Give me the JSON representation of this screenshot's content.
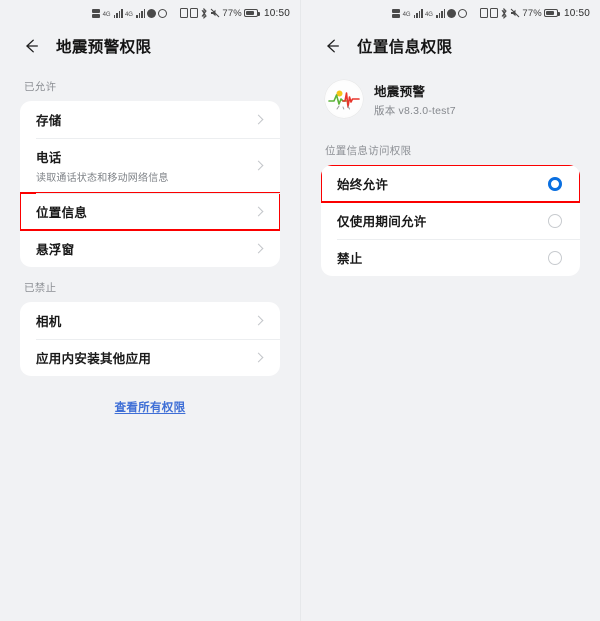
{
  "colors": {
    "page_bg": "#f1f2f4",
    "card_bg": "#ffffff",
    "accent_blue": "#0a6fe0",
    "link_blue": "#3f6fd6",
    "highlight_red": "#fb0000",
    "muted_text": "#8c8f94"
  },
  "status_bar": {
    "battery_percent": "77%",
    "time": "10:50",
    "icons": [
      "sim-dual-signal-icon",
      "signal-bars-icon",
      "signal-bars-icon",
      "circle-icon",
      "globe-icon",
      "nfc-icon",
      "alarm-icon",
      "bluetooth-icon",
      "mute-icon",
      "battery-icon"
    ]
  },
  "left_screen": {
    "header": {
      "title": "地震预警权限",
      "back_label": "返回"
    },
    "sections": [
      {
        "label": "已允许",
        "rows": [
          {
            "title": "存储",
            "sub": "",
            "highlighted": false
          },
          {
            "title": "电话",
            "sub": "读取通话状态和移动网络信息",
            "highlighted": false
          },
          {
            "title": "位置信息",
            "sub": "",
            "highlighted": true
          },
          {
            "title": "悬浮窗",
            "sub": "",
            "highlighted": false
          }
        ]
      },
      {
        "label": "已禁止",
        "rows": [
          {
            "title": "相机",
            "sub": "",
            "highlighted": false
          },
          {
            "title": "应用内安装其他应用",
            "sub": "",
            "highlighted": false
          }
        ]
      }
    ],
    "all_permissions_link": "查看所有权限"
  },
  "right_screen": {
    "header": {
      "title": "位置信息权限",
      "back_label": "返回"
    },
    "app": {
      "name": "地震预警",
      "version": "版本 v8.3.0-test7",
      "icon_name": "earthquake-warning-app-icon"
    },
    "permission_section_label": "位置信息访问权限",
    "options": [
      {
        "label": "始终允许",
        "selected": true,
        "highlighted": true
      },
      {
        "label": "仅使用期间允许",
        "selected": false,
        "highlighted": false
      },
      {
        "label": "禁止",
        "selected": false,
        "highlighted": false
      }
    ]
  }
}
